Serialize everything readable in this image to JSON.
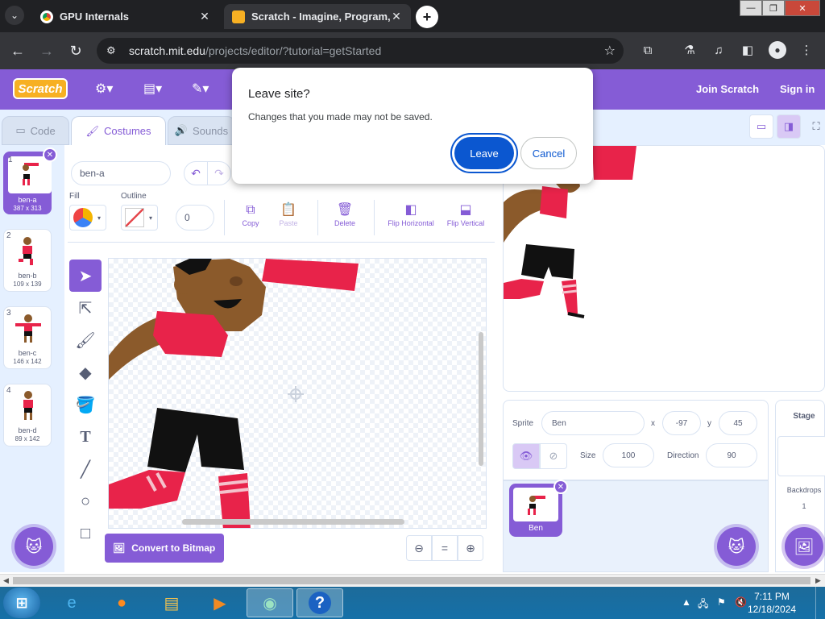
{
  "browser": {
    "tabs": [
      {
        "title": "GPU Internals",
        "close": "✕"
      },
      {
        "title": "Scratch - Imagine, Program, Sh",
        "close": "✕"
      }
    ],
    "url_host": "scratch.mit.edu",
    "url_path": "/projects/editor/?tutorial=getStarted"
  },
  "menubar": {
    "logo": "Scratch",
    "join": "Join Scratch",
    "signin": "Sign in"
  },
  "editor_tabs": {
    "code": "Code",
    "costumes": "Costumes",
    "sounds": "Sounds"
  },
  "costumes": [
    {
      "num": "1",
      "name": "ben-a",
      "size": "387 x 313"
    },
    {
      "num": "2",
      "name": "ben-b",
      "size": "109 x 139"
    },
    {
      "num": "3",
      "name": "ben-c",
      "size": "146 x 142"
    },
    {
      "num": "4",
      "name": "ben-d",
      "size": "89 x 142"
    }
  ],
  "paint": {
    "costume_name": "ben-a",
    "fill_label": "Fill",
    "outline_label": "Outline",
    "outline_width": "0",
    "copy": "Copy",
    "paste": "Paste",
    "delete": "Delete",
    "flip_h": "Flip Horizontal",
    "flip_v": "Flip Vertical",
    "convert": "Convert to Bitmap"
  },
  "sprite": {
    "sprite_label": "Sprite",
    "name": "Ben",
    "x_label": "x",
    "x": "-97",
    "y_label": "y",
    "y": "45",
    "size_label": "Size",
    "size": "100",
    "direction_label": "Direction",
    "direction": "90",
    "tile_name": "Ben"
  },
  "stage_panel": {
    "title": "Stage",
    "backdrops_label": "Backdrops",
    "backdrops_count": "1"
  },
  "dialog": {
    "title": "Leave site?",
    "message": "Changes that you made may not be saved.",
    "leave": "Leave",
    "cancel": "Cancel"
  },
  "taskbar": {
    "time": "7:11 PM",
    "date": "12/18/2024"
  },
  "colors": {
    "scratch_purple": "#855cd6",
    "dialog_blue": "#0b57d0"
  }
}
